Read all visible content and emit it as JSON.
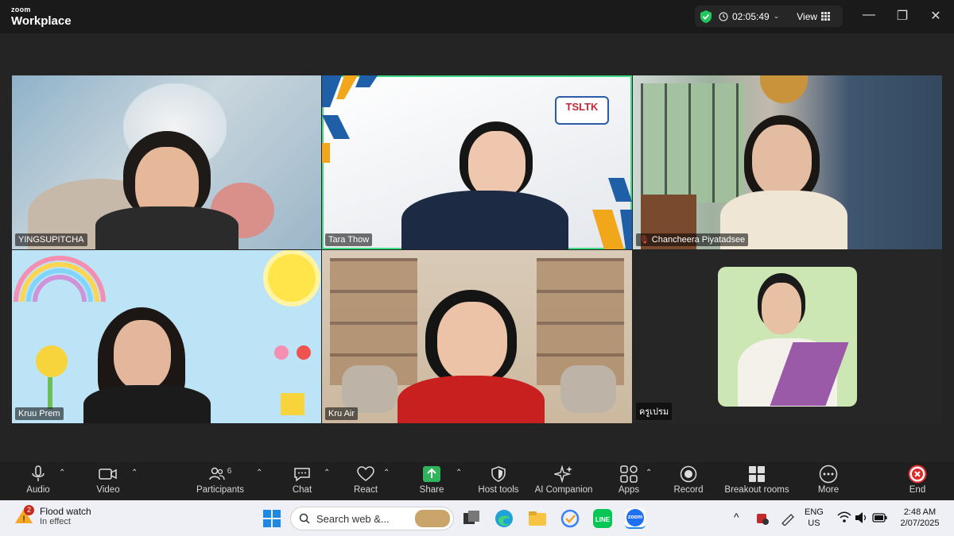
{
  "app": {
    "brand_small": "zoom",
    "brand_big": "Workplace"
  },
  "header": {
    "timer": "02:05:49",
    "view_label": "View"
  },
  "participants": [
    {
      "name": "YINGSUPITCHA",
      "active": false,
      "muted": false
    },
    {
      "name": "Tara Thow",
      "active": true,
      "muted": false
    },
    {
      "name": "Chancheera Piyatadsee",
      "active": false,
      "muted": true
    },
    {
      "name": "Kruu Prem",
      "active": false,
      "muted": false
    },
    {
      "name": "Kru Air",
      "active": false,
      "muted": false
    },
    {
      "name": "ครูเปรม",
      "active": false,
      "muted": false
    }
  ],
  "logo_text": "TSLTK",
  "toolbar": {
    "audio": "Audio",
    "video": "Video",
    "participants": "Participants",
    "participants_count": "6",
    "chat": "Chat",
    "react": "React",
    "share": "Share",
    "host_tools": "Host tools",
    "ai_companion": "AI Companion",
    "apps": "Apps",
    "record": "Record",
    "breakout_rooms": "Breakout rooms",
    "more": "More",
    "end": "End"
  },
  "taskbar": {
    "weather_title": "Flood watch",
    "weather_sub": "In effect",
    "weather_badge": "2",
    "search_placeholder": "Search web &...",
    "lang_top": "ENG",
    "lang_bottom": "US",
    "time": "2:48 AM",
    "date": "2/07/2025",
    "zoom_label": "zoom"
  },
  "colors": {
    "active_border": "#3ddc84",
    "share_green": "#2fb35b",
    "end_red": "#e02828",
    "shield_green": "#22c55e"
  }
}
